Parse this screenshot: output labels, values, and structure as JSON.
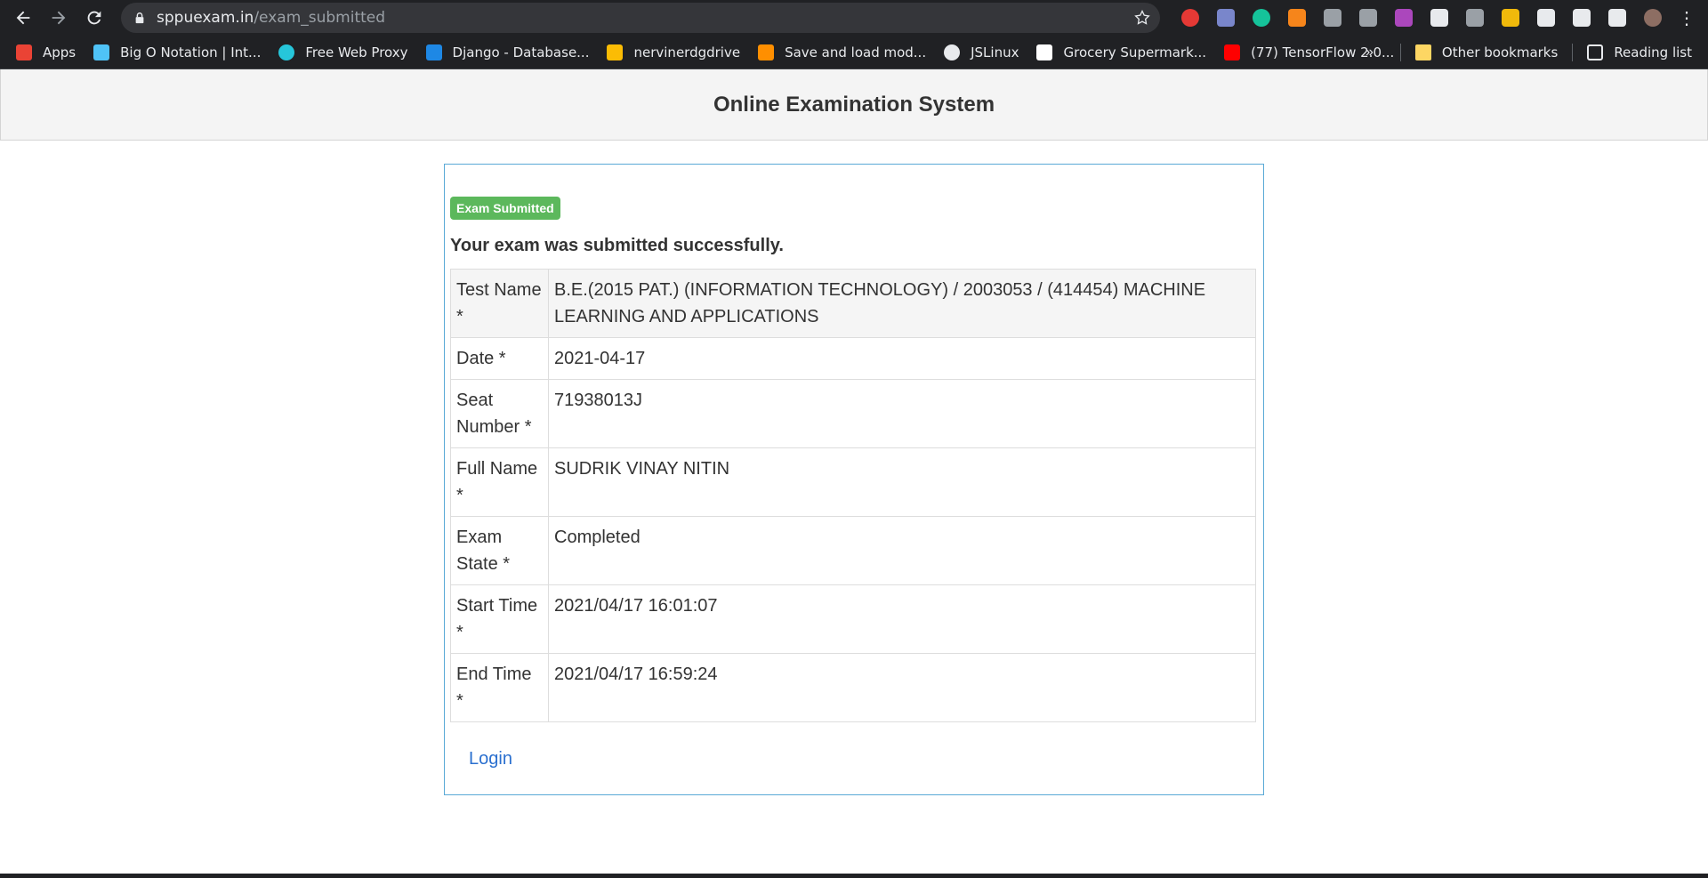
{
  "browser": {
    "url_domain": "sppuexam.in",
    "url_path": "/exam_submitted",
    "bookmarks": [
      {
        "label": "Apps",
        "icon": "apps-grid-icon",
        "color": "#ea4335"
      },
      {
        "label": "Big O Notation | Int...",
        "icon": "book-icon",
        "color": "#4fc3f7"
      },
      {
        "label": "Free Web Proxy",
        "icon": "w-logo-icon",
        "color": "#26c6da"
      },
      {
        "label": "Django - Database...",
        "icon": "django-icon",
        "color": "#1e88e5"
      },
      {
        "label": "nervinerdgdrive",
        "icon": "google-drive-icon",
        "color": "#fbbc04"
      },
      {
        "label": "Save and load mod...",
        "icon": "tensorflow-icon",
        "color": "#ff8f00"
      },
      {
        "label": "JSLinux",
        "icon": "globe-icon",
        "color": "#e8eaed"
      },
      {
        "label": "Grocery Supermark...",
        "icon": "grocery-icon",
        "color": "#ffffff"
      },
      {
        "label": "(77) TensorFlow 2.0...",
        "icon": "youtube-icon",
        "color": "#ff0000"
      }
    ],
    "other_bookmarks": "Other bookmarks",
    "reading_list": "Reading list",
    "overflow": "»",
    "extensions": [
      {
        "icon": "adblock-icon",
        "color": "#e53935"
      },
      {
        "icon": "pen-icon",
        "color": "#7986cb"
      },
      {
        "icon": "grammarly-icon",
        "color": "#15c39a"
      },
      {
        "icon": "metamask-icon",
        "color": "#f6851b"
      },
      {
        "icon": "camera-icon",
        "color": "#9aa0a6"
      },
      {
        "icon": "shield-icon",
        "color": "#9aa0a6"
      },
      {
        "icon": "color-wheel-icon",
        "color": "#ab47bc"
      },
      {
        "icon": "clipboard-icon",
        "color": "#e8eaed"
      },
      {
        "icon": "font-icon",
        "color": "#9aa0a6"
      },
      {
        "icon": "binance-icon",
        "color": "#f0b90b"
      },
      {
        "icon": "gnome-icon",
        "color": "#e8eaed"
      },
      {
        "icon": "puzzle-icon",
        "color": "#e8eaed"
      },
      {
        "icon": "playlist-icon",
        "color": "#e8eaed"
      },
      {
        "icon": "profile-avatar-icon",
        "color": "#8d6e63"
      }
    ]
  },
  "page": {
    "site_title": "Online Examination System",
    "badge": "Exam Submitted",
    "success_message": "Your exam was submitted successfully.",
    "details": [
      {
        "label": "Test Name *",
        "value": "B.E.(2015 PAT.) (INFORMATION TECHNOLOGY) / 2003053 / (414454) MACHINE LEARNING AND APPLICATIONS"
      },
      {
        "label": "Date *",
        "value": "2021-04-17"
      },
      {
        "label": "Seat Number *",
        "value": "71938013J"
      },
      {
        "label": "Full Name *",
        "value": "SUDRIK VINAY NITIN"
      },
      {
        "label": "Exam State *",
        "value": "Completed"
      },
      {
        "label": "Start Time *",
        "value": "2021/04/17 16:01:07"
      },
      {
        "label": "End Time *",
        "value": "2021/04/17 16:59:24"
      }
    ],
    "login_link": "Login"
  },
  "colors": {
    "badge_bg": "#5cb85c",
    "panel_border": "#5aa9d6",
    "link": "#2a6fcf"
  }
}
